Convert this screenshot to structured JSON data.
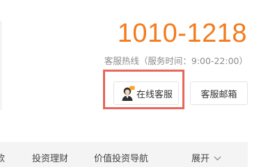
{
  "service": {
    "hotline_number": "1010-1218",
    "hotline_label": "客服热线（服务时间：9:00-22:00）",
    "online_button_label": "在线客服",
    "email_button_label": "客服邮箱"
  },
  "subnav": {
    "items": [
      "款",
      "投资理财",
      "价值投资导航",
      "展开"
    ]
  },
  "icons": {
    "online_service": "customer-service-agent-icon",
    "expand": "chevron-down-icon"
  },
  "colors": {
    "accent": "#f37b1d",
    "highlight": "#e8665a"
  }
}
